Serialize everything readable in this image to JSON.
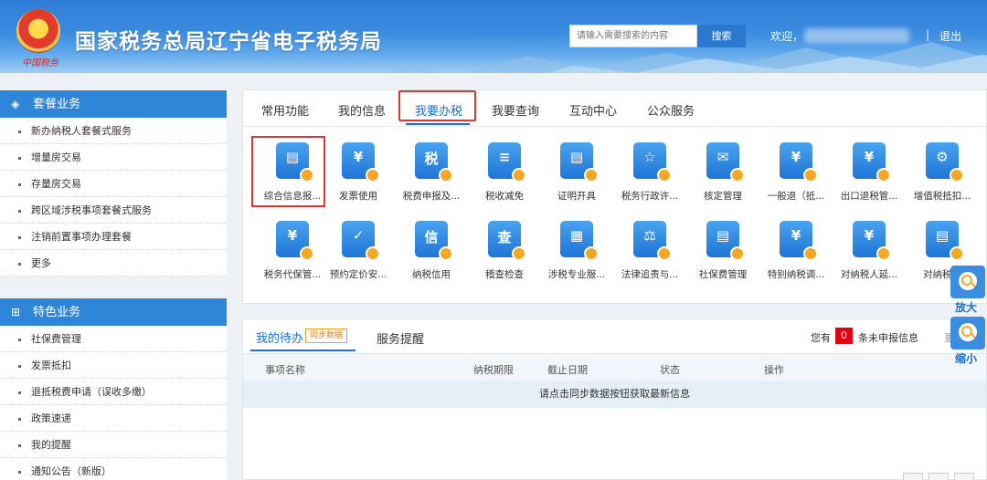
{
  "header": {
    "title": "国家税务总局辽宁省电子税务局",
    "seal_text": "中国税务",
    "search_placeholder": "请输入需要搜索的内容",
    "search_button": "搜索",
    "greeting": "欢迎，",
    "separator": "|",
    "logout": "退出"
  },
  "sidebar": {
    "groups": [
      {
        "title": "套餐业务",
        "icon": "layers-icon",
        "items": [
          "新办纳税人套餐式服务",
          "增量房交易",
          "存量房交易",
          "跨区域涉税事项套餐式服务",
          "注销前置事项办理套餐",
          "更多"
        ]
      },
      {
        "title": "特色业务",
        "icon": "grid-icon",
        "items": [
          "社保费管理",
          "发票抵扣",
          "退抵税费申请（误收多缴）",
          "政策速递",
          "我的提醒",
          "通知公告（新版）"
        ]
      }
    ]
  },
  "main": {
    "tabs": [
      "常用功能",
      "我的信息",
      "我要办税",
      "我要查询",
      "互动中心",
      "公众服务"
    ],
    "active_tab": "我要办税",
    "functions": [
      {
        "label": "综合信息报...",
        "icon": "report-mic-icon",
        "glyph": "▤"
      },
      {
        "label": "发票使用",
        "icon": "invoice-icon",
        "glyph": "¥"
      },
      {
        "label": "税费申报及...",
        "icon": "tax-declare-icon",
        "glyph": "税"
      },
      {
        "label": "税收减免",
        "icon": "tax-relief-icon",
        "glyph": "≡"
      },
      {
        "label": "证明开具",
        "icon": "certificate-icon",
        "glyph": "▤"
      },
      {
        "label": "税务行政许...",
        "icon": "admin-permit-icon",
        "glyph": "☆"
      },
      {
        "label": "核定管理",
        "icon": "assessment-icon",
        "glyph": "✉"
      },
      {
        "label": "一般退（抵...",
        "icon": "refund-icon",
        "glyph": "¥"
      },
      {
        "label": "出口退税管...",
        "icon": "export-refund-icon",
        "glyph": "¥"
      },
      {
        "label": "增值税抵扣...",
        "icon": "vat-deduct-icon",
        "glyph": "⚙"
      },
      {
        "label": "税务代保管...",
        "icon": "custody-icon",
        "glyph": "¥"
      },
      {
        "label": "预约定价安...",
        "icon": "pricing-icon",
        "glyph": "✓"
      },
      {
        "label": "纳税信用",
        "icon": "credit-icon",
        "glyph": "信"
      },
      {
        "label": "稽查检查",
        "icon": "inspection-icon",
        "glyph": "查"
      },
      {
        "label": "涉税专业服...",
        "icon": "professional-service-icon",
        "glyph": "▦"
      },
      {
        "label": "法律追责与...",
        "icon": "legal-icon",
        "glyph": "⚖"
      },
      {
        "label": "社保费管理",
        "icon": "social-insurance-icon",
        "glyph": "▤"
      },
      {
        "label": "特别纳税调...",
        "icon": "special-adjust-icon",
        "glyph": "¥"
      },
      {
        "label": "对纳税人延...",
        "icon": "taxpayer-delay-icon",
        "glyph": "¥"
      },
      {
        "label": "对纳税人",
        "icon": "taxpayer-icon",
        "glyph": "▤"
      }
    ]
  },
  "todo": {
    "tab_mine": "我的待办",
    "sync_label": "同步数据",
    "tab_reminder": "服务提醒",
    "you_have": "您有",
    "count": "0",
    "unfiled_text": "条未申报信息",
    "more": "更",
    "columns": [
      "事项名称",
      "纳税期限",
      "截止日期",
      "状态",
      "操作"
    ],
    "empty_message": "请点击同步数据按钮获取最新信息"
  },
  "zoom": {
    "zoom_in": "放大",
    "zoom_out": "缩小"
  },
  "colors": {
    "accent": "#1a6fd0",
    "highlight": "#e8322c",
    "sidebar_head": "#2f86d8",
    "badge": "#e60012"
  }
}
